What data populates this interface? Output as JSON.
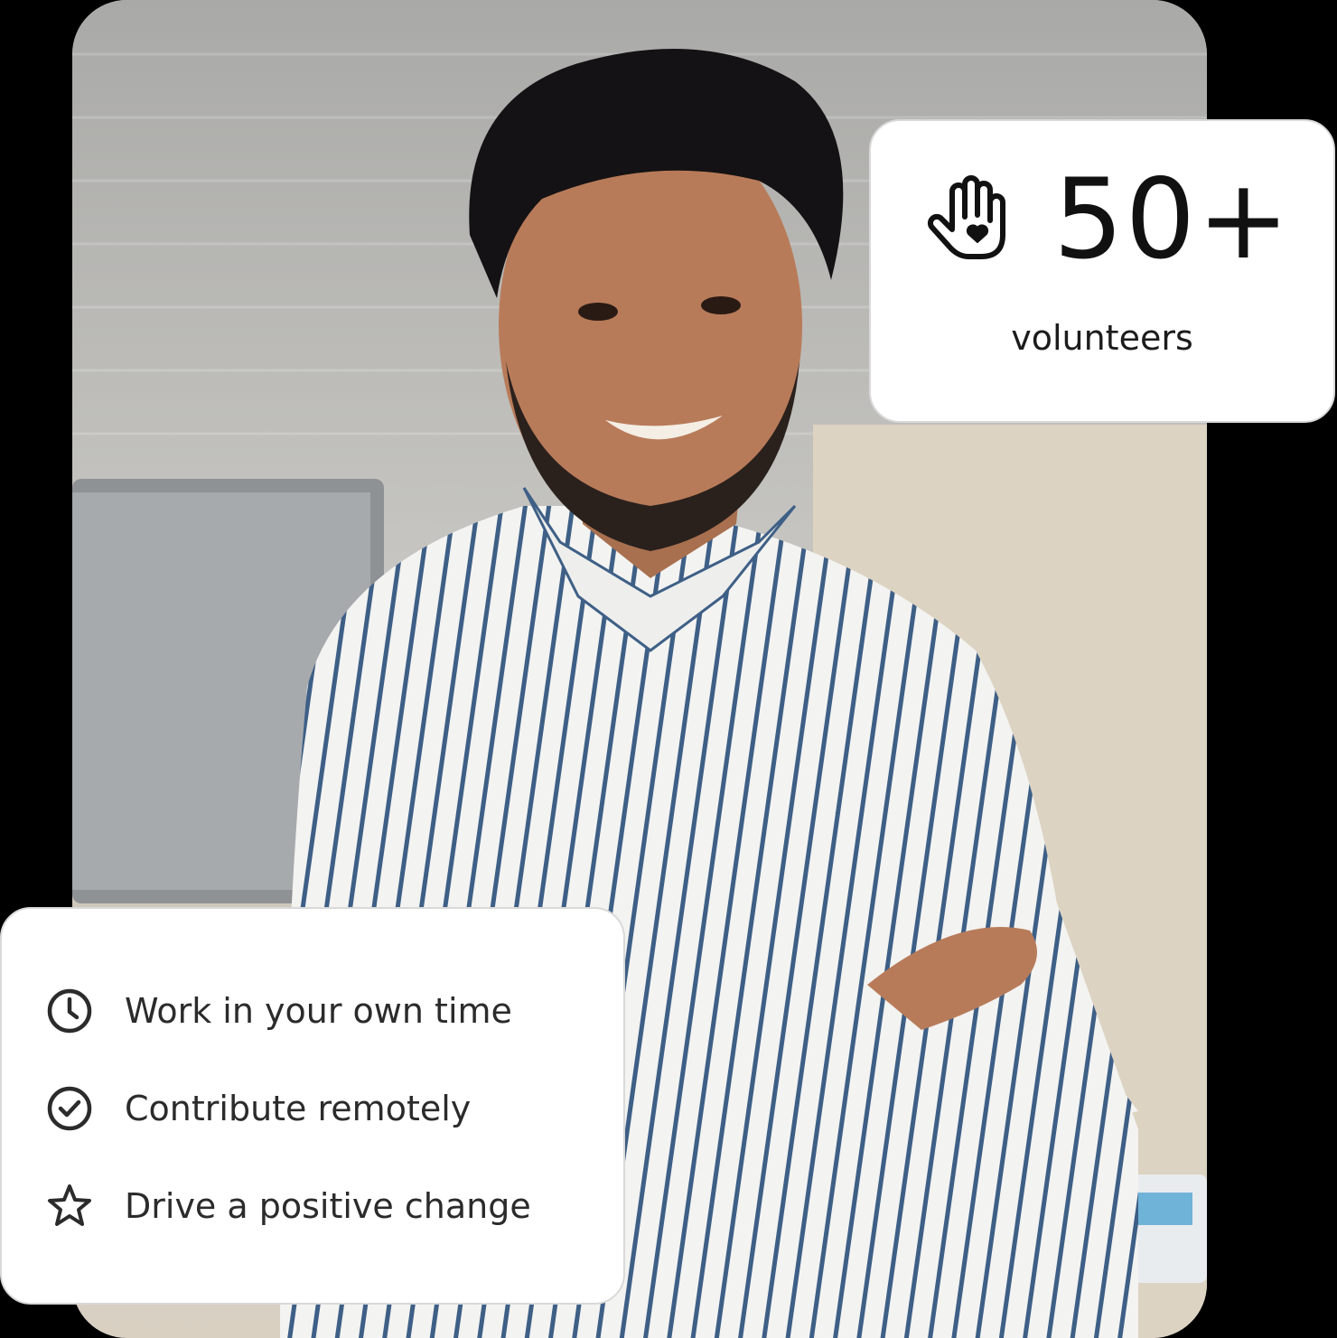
{
  "stat": {
    "icon": "volunteer-hand-heart-icon",
    "value": "50+",
    "label": "volunteers"
  },
  "benefits": [
    {
      "icon": "clock-icon",
      "text": "Work in your own time"
    },
    {
      "icon": "check-circle-icon",
      "text": "Contribute remotely"
    },
    {
      "icon": "star-icon",
      "text": "Drive a positive change"
    }
  ],
  "colors": {
    "card_background": "#ffffff",
    "card_border": "#d9d9d9",
    "text_primary": "#111111",
    "page_background": "#000000"
  }
}
